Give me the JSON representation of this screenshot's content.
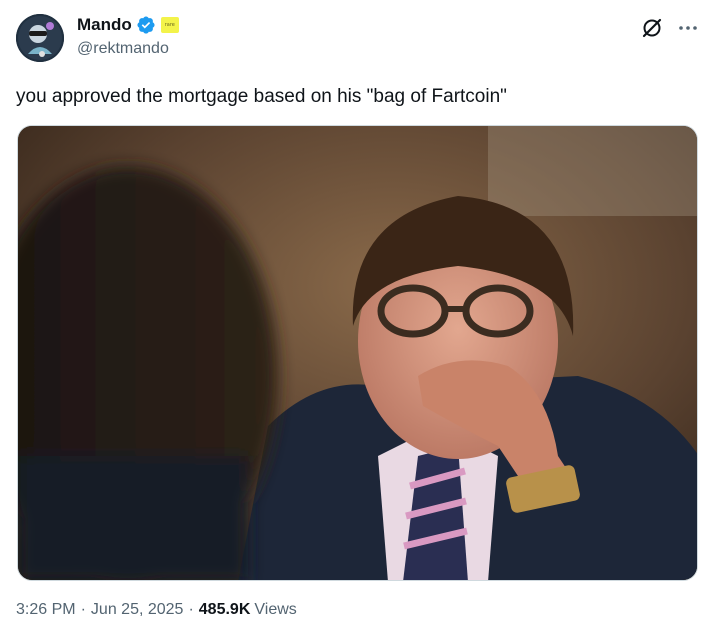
{
  "author": {
    "display_name": "Mando",
    "handle": "@rektmando",
    "avatar_icon": "avatar-image",
    "verified_icon": "verified-badge-icon",
    "badge_icon": "affiliate-badge-icon",
    "badge_text": "rare"
  },
  "header_icons": {
    "grok": "grok-icon",
    "more": "more-icon"
  },
  "tweet": {
    "text": "you approved the mortgage based on his \"bag of Fartcoin\""
  },
  "media": {
    "kind": "photo"
  },
  "meta": {
    "time": "3:26 PM",
    "separator": "·",
    "date": "Jun 25, 2025",
    "views_count": "485.9K",
    "views_label": "Views"
  },
  "colors": {
    "verified": "#1d9bf0",
    "secondary_text": "#536471",
    "primary_text": "#0f1419"
  }
}
